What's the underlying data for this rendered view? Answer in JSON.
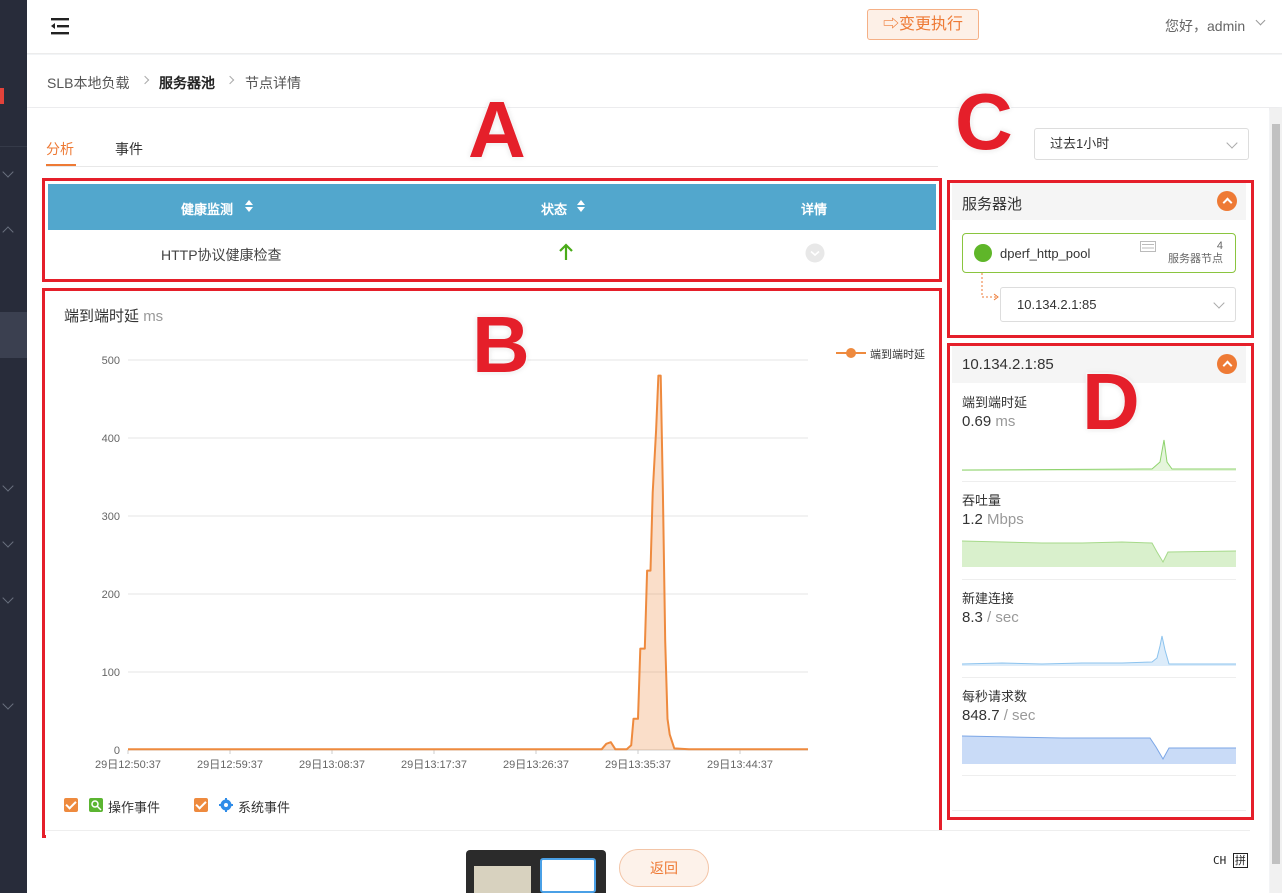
{
  "header": {
    "exec_button": "⇨变更执行",
    "greeting": "您好，admin"
  },
  "breadcrumb": [
    "SLB本地负载",
    "服务器池",
    "节点详情"
  ],
  "tabs": [
    "分析",
    "事件"
  ],
  "time_range": "过去1小时",
  "health_table": {
    "columns": [
      "健康监测",
      "状态",
      "详情"
    ],
    "rows": [
      {
        "check": "HTTP协议健康检查",
        "status": "up"
      }
    ]
  },
  "latency_chart": {
    "title": "端到端时延",
    "unit": "ms",
    "legend": "端到端时延",
    "events": [
      "操作事件",
      "系统事件"
    ]
  },
  "chart_data": {
    "type": "area",
    "x_ticks": [
      "29日12:50:37",
      "29日12:59:37",
      "29日13:08:37",
      "29日13:17:37",
      "29日13:26:37",
      "29日13:35:37",
      "29日13:44:37"
    ],
    "y_ticks": [
      "0",
      "100",
      "200",
      "300",
      "400",
      "500"
    ],
    "ylim": [
      0,
      500
    ],
    "xlim_minutes": [
      0,
      60
    ],
    "series": [
      {
        "name": "端到端时延",
        "color": "#ee8a3e",
        "points": [
          [
            0,
            1
          ],
          [
            30,
            1
          ],
          [
            41.8,
            1
          ],
          [
            42.2,
            8
          ],
          [
            42.6,
            10
          ],
          [
            43.0,
            1
          ],
          [
            44.0,
            1
          ],
          [
            44.4,
            6
          ],
          [
            44.6,
            40
          ],
          [
            45.0,
            40
          ],
          [
            45.2,
            130
          ],
          [
            45.6,
            130
          ],
          [
            45.8,
            230
          ],
          [
            46.1,
            230
          ],
          [
            46.3,
            330
          ],
          [
            46.6,
            410
          ],
          [
            46.8,
            480
          ],
          [
            47.0,
            480
          ],
          [
            47.2,
            330
          ],
          [
            47.4,
            140
          ],
          [
            47.6,
            40
          ],
          [
            47.8,
            20
          ],
          [
            48.2,
            2
          ],
          [
            49.5,
            1
          ],
          [
            60,
            1
          ]
        ]
      }
    ],
    "grid": true,
    "legend_position": "top-right"
  },
  "server_pool": {
    "title": "服务器池",
    "pool_name": "dperf_http_pool",
    "node_count": "4",
    "node_count_label": "服务器节点",
    "selected_node": "10.134.2.1:85"
  },
  "node_metrics": {
    "title": "10.134.2.1:85",
    "items": [
      {
        "label": "端到端时延",
        "value": "0.69",
        "unit": "ms",
        "color": "#8fd36e",
        "fill": "#e5f5dc"
      },
      {
        "label": "吞吐量",
        "value": "1.2",
        "unit": "Mbps",
        "color": "#a6d98a",
        "fill": "#d9f0cc"
      },
      {
        "label": "新建连接",
        "value": "8.3",
        "unit": "/ sec",
        "color": "#8cc3ee",
        "fill": "#dcecfa"
      },
      {
        "label": "每秒请求数",
        "value": "848.7",
        "unit": "/ sec",
        "color": "#7ba6e6",
        "fill": "#c9dbf7"
      }
    ]
  },
  "annotations": [
    "A",
    "B",
    "C",
    "D"
  ],
  "back_button": "返回",
  "ime": {
    "mode": "CH",
    "input": "拼"
  }
}
